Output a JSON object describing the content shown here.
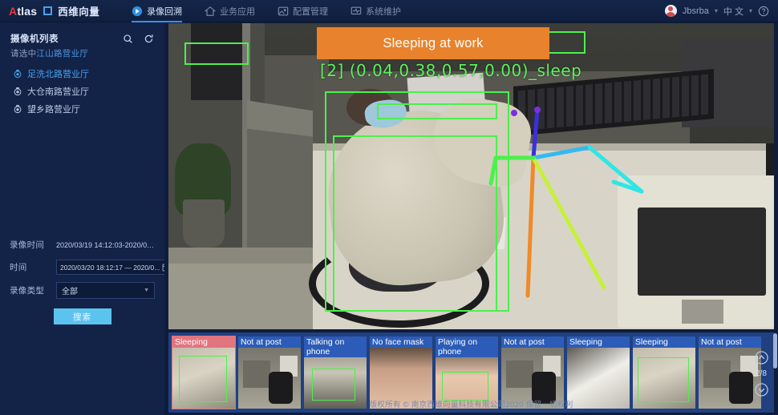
{
  "header": {
    "logo_en": "Atlas",
    "logo_cn": "西维向量",
    "nav": [
      {
        "label": "录像回溯",
        "icon": "play-circle-icon",
        "active": true
      },
      {
        "label": "业务应用",
        "icon": "home-icon",
        "active": false
      },
      {
        "label": "配置管理",
        "icon": "image-config-icon",
        "active": false
      },
      {
        "label": "系统维护",
        "icon": "system-monitor-icon",
        "active": false
      }
    ],
    "user_name": "Jbsrba",
    "language": "中 文",
    "help_icon": "help-circle-icon"
  },
  "sidebar": {
    "title": "摄像机列表",
    "subtitle_prefix": "请选中",
    "subtitle_value": "江山路营业厅",
    "search_icon": "search-icon",
    "refresh_icon": "refresh-icon",
    "cameras": [
      {
        "label": "足洗北路营业厅",
        "active": true
      },
      {
        "label": "大仓南路营业厅",
        "active": false
      },
      {
        "label": "望乡路营业厅",
        "active": false
      }
    ],
    "filters": {
      "record_time_label": "录像时间",
      "record_time_value": "2020/03/19 14:12:03-2020/03...",
      "time_label": "时间",
      "time_value": "2020/03/20 18:12:17 — 2020/0...",
      "calendar_icon": "calendar-icon",
      "type_label": "录像类型",
      "type_value": "全部",
      "search_button": "搜索"
    }
  },
  "video": {
    "alert_banner": "Sleeping at work",
    "detection_text": "[2] (0.04,0.38,0.57,0.00)_sleep",
    "alert_color": "#e8822c",
    "box_color": "#4cf04c"
  },
  "strip": {
    "thumbnails": [
      {
        "label": "Sleeping",
        "kind": "sleep",
        "selected": true
      },
      {
        "label": "Not at post",
        "kind": "desk",
        "selected": false
      },
      {
        "label": "Talking\non phone",
        "kind": "phone",
        "selected": false
      },
      {
        "label": "No face mask",
        "kind": "face",
        "selected": false
      },
      {
        "label": "Playing\non phone",
        "kind": "phone2",
        "selected": false
      },
      {
        "label": "Not at post",
        "kind": "desk",
        "selected": false
      },
      {
        "label": "Sleeping",
        "kind": "white",
        "selected": false
      },
      {
        "label": "Sleeping",
        "kind": "sleep",
        "selected": false
      },
      {
        "label": "Not at post",
        "kind": "desk",
        "selected": false
      }
    ],
    "page_indicator": "2/8",
    "prev_icon": "chevron-up-circle-icon",
    "next_icon": "chevron-down-circle-icon"
  },
  "footer": {
    "copyright": "版权所有 © 南京西维向量科技有限公司2020 保留一切权利"
  }
}
